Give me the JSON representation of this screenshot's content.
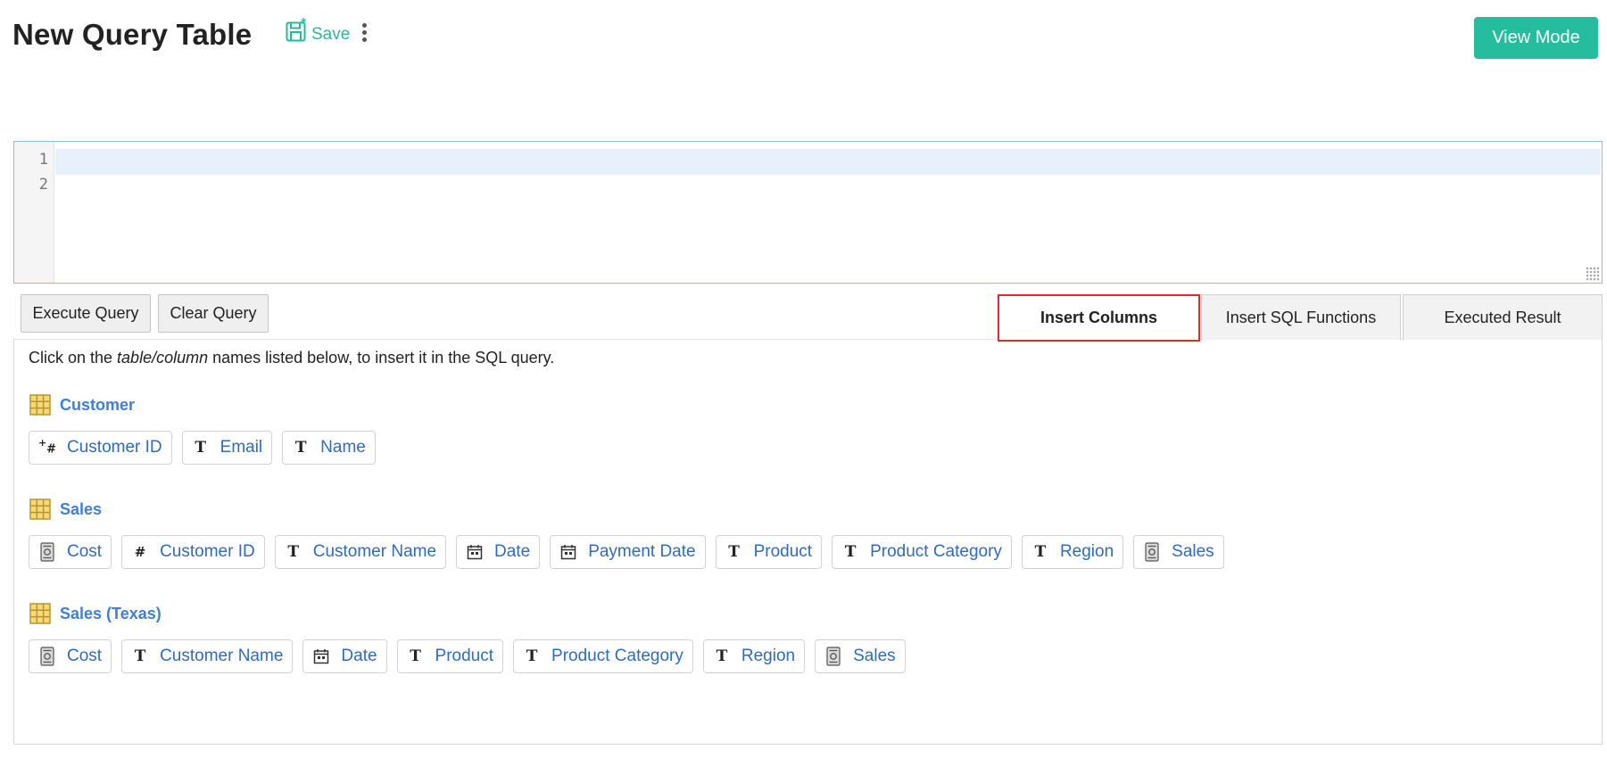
{
  "header": {
    "title": "New Query Table",
    "save_label": "Save",
    "view_mode_label": "View Mode"
  },
  "editor": {
    "line_numbers": [
      "1",
      "2"
    ]
  },
  "buttons": {
    "execute": "Execute Query",
    "clear": "Clear Query"
  },
  "tabs": [
    {
      "label": "Insert Columns",
      "active": true
    },
    {
      "label": "Insert SQL Functions",
      "active": false
    },
    {
      "label": "Executed Result",
      "active": false
    }
  ],
  "instruction": {
    "before": "Click on the ",
    "emphasis": "table/column",
    "after": " names listed below, to insert it in the SQL query."
  },
  "tables": [
    {
      "name": "Customer",
      "columns": [
        {
          "label": "Customer ID",
          "icon": "auto-number-icon"
        },
        {
          "label": "Email",
          "icon": "text-type-icon"
        },
        {
          "label": "Name",
          "icon": "text-type-icon"
        }
      ]
    },
    {
      "name": "Sales",
      "columns": [
        {
          "label": "Cost",
          "icon": "currency-icon"
        },
        {
          "label": "Customer ID",
          "icon": "number-icon"
        },
        {
          "label": "Customer Name",
          "icon": "text-type-icon"
        },
        {
          "label": "Date",
          "icon": "date-icon"
        },
        {
          "label": "Payment Date",
          "icon": "date-icon"
        },
        {
          "label": "Product",
          "icon": "text-type-icon"
        },
        {
          "label": "Product Category",
          "icon": "text-type-icon"
        },
        {
          "label": "Region",
          "icon": "text-type-icon"
        },
        {
          "label": "Sales",
          "icon": "currency-icon"
        }
      ]
    },
    {
      "name": "Sales (Texas)",
      "columns": [
        {
          "label": "Cost",
          "icon": "currency-icon"
        },
        {
          "label": "Customer Name",
          "icon": "text-type-icon"
        },
        {
          "label": "Date",
          "icon": "date-icon"
        },
        {
          "label": "Product",
          "icon": "text-type-icon"
        },
        {
          "label": "Product Category",
          "icon": "text-type-icon"
        },
        {
          "label": "Region",
          "icon": "text-type-icon"
        },
        {
          "label": "Sales",
          "icon": "currency-icon"
        }
      ]
    }
  ],
  "colors": {
    "accent": "#26bd9e",
    "link": "#2d6cc0",
    "table_title": "#3f7fd6",
    "active_tab_border": "#e12a2a"
  }
}
